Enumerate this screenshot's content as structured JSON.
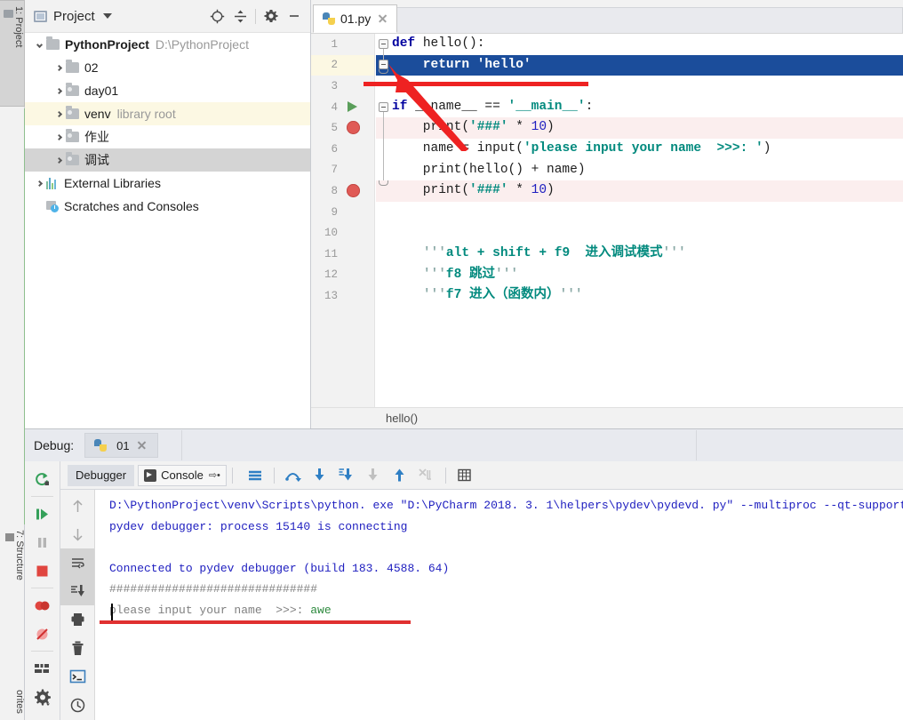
{
  "left_strip": {
    "tabs": [
      {
        "label": "1: Project",
        "icon": "folder-icon",
        "active": true
      },
      {
        "label": "7: Structure",
        "icon": "structure-icon",
        "active": false
      },
      {
        "label": "orites",
        "icon": "star-icon",
        "active": false
      }
    ]
  },
  "project_panel": {
    "title": "Project",
    "dropdown_icon": "chevron-down-icon",
    "toolbar": [
      {
        "name": "locate-icon",
        "label": ""
      },
      {
        "name": "collapse-all-icon",
        "label": ""
      },
      {
        "name": "gear-icon",
        "label": ""
      },
      {
        "name": "hide-icon",
        "label": ""
      }
    ],
    "tree": [
      {
        "name": "PythonProject",
        "sub": "D:\\PythonProject",
        "depth": 0,
        "expanded": true,
        "bold": true,
        "icon": "folder-icon",
        "state": "normal"
      },
      {
        "name": "02",
        "sub": "",
        "depth": 1,
        "expanded": false,
        "bold": false,
        "icon": "folder-icon",
        "state": "normal"
      },
      {
        "name": "day01",
        "sub": "",
        "depth": 1,
        "expanded": false,
        "bold": false,
        "icon": "source-folder-icon",
        "state": "normal"
      },
      {
        "name": "venv",
        "sub": "library root",
        "depth": 1,
        "expanded": false,
        "bold": false,
        "icon": "source-folder-icon",
        "state": "highlight"
      },
      {
        "name": "作业",
        "sub": "",
        "depth": 1,
        "expanded": false,
        "bold": false,
        "icon": "source-folder-icon",
        "state": "normal"
      },
      {
        "name": "调试",
        "sub": "",
        "depth": 1,
        "expanded": false,
        "bold": false,
        "icon": "source-folder-icon",
        "state": "selected"
      },
      {
        "name": "External Libraries",
        "sub": "",
        "depth": 0,
        "expanded": false,
        "bold": false,
        "icon": "library-icon",
        "state": "normal"
      },
      {
        "name": "Scratches and Consoles",
        "sub": "",
        "depth": 0,
        "expanded": null,
        "bold": false,
        "icon": "scratches-icon",
        "state": "normal"
      }
    ]
  },
  "editor": {
    "tabs": [
      {
        "label": "01.py",
        "icon": "python-file-icon",
        "close_icon": "close-icon",
        "active": true
      }
    ],
    "breadcrumb": "hello()",
    "lines": [
      {
        "num": "1",
        "tokens": [
          {
            "t": "def ",
            "c": "kw"
          },
          {
            "t": "hello",
            "c": "fn"
          },
          {
            "t": "():",
            "c": "pl"
          }
        ],
        "indent": 0,
        "row_bg": "none",
        "gutter": "none",
        "fold": "start"
      },
      {
        "num": "2",
        "tokens": [
          {
            "t": "    return ",
            "c": "kw"
          },
          {
            "t": "'hello'",
            "c": "str"
          }
        ],
        "indent": 0,
        "row_bg": "selected",
        "gutter": "none",
        "fold": "end"
      },
      {
        "num": "3",
        "tokens": [],
        "indent": 0,
        "row_bg": "none",
        "gutter": "none",
        "fold": "none"
      },
      {
        "num": "4",
        "tokens": [
          {
            "t": "if ",
            "c": "kw"
          },
          {
            "t": "__name__",
            "c": "dunder"
          },
          {
            "t": " == ",
            "c": "pl"
          },
          {
            "t": "'__main__'",
            "c": "str"
          },
          {
            "t": ":",
            "c": "pl"
          }
        ],
        "indent": 0,
        "row_bg": "none",
        "gutter": "run",
        "fold": "start"
      },
      {
        "num": "5",
        "tokens": [
          {
            "t": "    print(",
            "c": "pl"
          },
          {
            "t": "'###'",
            "c": "str"
          },
          {
            "t": " * ",
            "c": "pl"
          },
          {
            "t": "10",
            "c": "num"
          },
          {
            "t": ")",
            "c": "pl"
          }
        ],
        "indent": 0,
        "row_bg": "pink",
        "gutter": "breakpoint",
        "fold": "none"
      },
      {
        "num": "6",
        "tokens": [
          {
            "t": "    name = input(",
            "c": "pl"
          },
          {
            "t": "'please input your name  >>>: '",
            "c": "str"
          },
          {
            "t": ")",
            "c": "pl"
          }
        ],
        "indent": 0,
        "row_bg": "none",
        "gutter": "none",
        "fold": "none"
      },
      {
        "num": "7",
        "tokens": [
          {
            "t": "    print(hello() + name)",
            "c": "pl"
          }
        ],
        "indent": 0,
        "row_bg": "none",
        "gutter": "none",
        "fold": "none"
      },
      {
        "num": "8",
        "tokens": [
          {
            "t": "    print(",
            "c": "pl"
          },
          {
            "t": "'###'",
            "c": "str"
          },
          {
            "t": " * ",
            "c": "pl"
          },
          {
            "t": "10",
            "c": "num"
          },
          {
            "t": ")",
            "c": "pl"
          }
        ],
        "indent": 0,
        "row_bg": "pink",
        "gutter": "breakpoint",
        "fold": "end"
      },
      {
        "num": "9",
        "tokens": [],
        "indent": 0,
        "row_bg": "none",
        "gutter": "none",
        "fold": "none"
      },
      {
        "num": "10",
        "tokens": [],
        "indent": 0,
        "row_bg": "none",
        "gutter": "none",
        "fold": "none"
      },
      {
        "num": "11",
        "tokens": [
          {
            "t": "    ",
            "c": "pl"
          },
          {
            "t": "'''",
            "c": "cmtq"
          },
          {
            "t": "alt + shift + f9  进入调试模式",
            "c": "cmt"
          },
          {
            "t": "'''",
            "c": "cmtq"
          }
        ],
        "indent": 0,
        "row_bg": "none",
        "gutter": "none",
        "fold": "none"
      },
      {
        "num": "12",
        "tokens": [
          {
            "t": "    ",
            "c": "pl"
          },
          {
            "t": "'''",
            "c": "cmtq"
          },
          {
            "t": "f8 跳过",
            "c": "cmt"
          },
          {
            "t": "'''",
            "c": "cmtq"
          }
        ],
        "indent": 0,
        "row_bg": "none",
        "gutter": "none",
        "fold": "none"
      },
      {
        "num": "13",
        "tokens": [
          {
            "t": "    ",
            "c": "pl"
          },
          {
            "t": "'''",
            "c": "cmtq"
          },
          {
            "t": "f7 进入（函数内）",
            "c": "cmt"
          },
          {
            "t": "'''",
            "c": "cmtq"
          }
        ],
        "indent": 0,
        "row_bg": "none",
        "gutter": "none",
        "fold": "none"
      }
    ],
    "selection_color": "#1b4d9b",
    "breakpoint_color": "#e05a56",
    "run_marker_color": "#5a9e5a"
  },
  "debug": {
    "label": "Debug:",
    "run_config": {
      "name": "01",
      "icon": "python-run-icon",
      "close_icon": "close-icon"
    },
    "sidebar_buttons": [
      {
        "name": "rerun-icon"
      },
      {
        "name": "resume-program-icon"
      },
      {
        "name": "pause-program-icon"
      },
      {
        "name": "stop-icon"
      },
      {
        "name": "view-breakpoints-icon"
      },
      {
        "name": "mute-breakpoints-icon"
      },
      {
        "name": "settings-layout-icon"
      },
      {
        "name": "gear-icon"
      }
    ],
    "subtabs": [
      {
        "label": "Debugger",
        "active": false,
        "icon": ""
      },
      {
        "label": "Console",
        "active": true,
        "icon": "console-icon",
        "pin_icon": "pin-icon"
      }
    ],
    "toolbar_buttons": [
      {
        "name": "soft-wrap-icon"
      },
      {
        "name": "step-over-icon"
      },
      {
        "name": "step-into-icon"
      },
      {
        "name": "force-step-into-icon"
      },
      {
        "name": "step-out-disabled-icon"
      },
      {
        "name": "step-up-icon"
      },
      {
        "name": "run-to-cursor-disabled-icon"
      },
      {
        "name": "evaluate-expression-icon"
      }
    ],
    "secondary_buttons": [
      {
        "name": "up-arrow-icon"
      },
      {
        "name": "down-arrow-icon"
      },
      {
        "name": "soft-wrap-lines-icon"
      },
      {
        "name": "scroll-to-end-icon"
      },
      {
        "name": "print-icon"
      },
      {
        "name": "clear-all-icon"
      },
      {
        "name": "terminal-icon"
      },
      {
        "name": "history-icon"
      }
    ],
    "console_lines": [
      {
        "text": "D:\\PythonProject\\venv\\Scripts\\python. exe \"D:\\PyCharm 2018. 3. 1\\helpers\\pydev\\pydevd. py\" --multiproc --qt-support=",
        "cls": "cerr"
      },
      {
        "text": "pydev debugger: process 15140 is connecting",
        "cls": "cerr"
      },
      {
        "text": "",
        "cls": "cerr"
      },
      {
        "text": "Connected to pydev debugger (build 183. 4588. 64)",
        "cls": "cerr"
      },
      {
        "text": "##############################",
        "cls": "cgray"
      },
      {
        "text": "please input your name  >>>: awe",
        "cls": "mixed",
        "parts": [
          {
            "text": "please input your name  >>>: ",
            "cls": "cgray"
          },
          {
            "text": "awe",
            "cls": "cgreen"
          }
        ]
      }
    ]
  },
  "annotations": {
    "arrow_color": "#ee2222",
    "editor_underline": "red-underline-line-2",
    "console_underline": "red-underline-input-line"
  }
}
